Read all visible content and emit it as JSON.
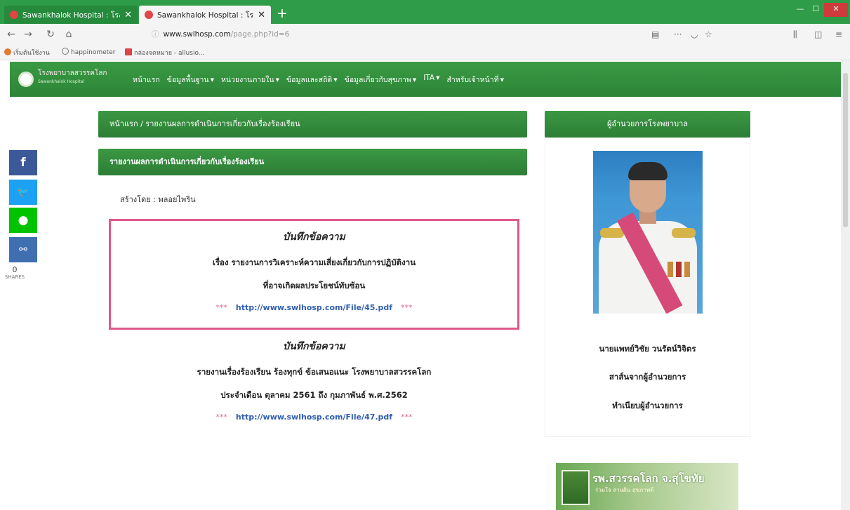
{
  "browser": {
    "tabs": [
      {
        "title": "Sawankhalok Hospital : โรงพ..."
      },
      {
        "title": "Sawankhalok Hospital : โรงพ..."
      }
    ],
    "new_tab": "+",
    "url_host": "www.swlhosp.com",
    "url_path": "/page.php?id=6",
    "bookmarks": [
      "เริ่มต้นใช้งาน",
      "happinometer",
      "กล่องจดหมาย - allusio..."
    ]
  },
  "site": {
    "logo_name": "โรงพยาบาลสวรรคโลก",
    "logo_sub": "Sawankhalok Hospital",
    "menu": [
      {
        "label": "หน้าแรก",
        "has_caret": false
      },
      {
        "label": "ข้อมูลพื้นฐาน",
        "has_caret": true
      },
      {
        "label": "หน่วยงานภายใน",
        "has_caret": true
      },
      {
        "label": "ข้อมูลและสถิติ",
        "has_caret": true
      },
      {
        "label": "ข้อมูลเกี่ยวกับสุขภาพ",
        "has_caret": true
      },
      {
        "label": "ITA",
        "has_caret": true
      },
      {
        "label": "สำหรับเจ้าหน้าที่",
        "has_caret": true
      }
    ]
  },
  "social": {
    "share_count": "0",
    "share_label": "SHARES",
    "colors": {
      "facebook": "#3b5998",
      "twitter": "#1da1f2",
      "line": "#00c300",
      "link": "#3f6fb0"
    }
  },
  "main": {
    "breadcrumb": "หน้าแรก / รายงานผลการดำเนินการเกี่ยวกับเรื่องร้องเรียน",
    "panel_title": "รายงานผลการดำเนินการเกี่ยวกับเรื่องร้องเรียน",
    "author": "สร้างโดย : พลอยไพริน",
    "memos": [
      {
        "title": "บันทึกข้อความ",
        "line1": "เรื่อง รายงานการวิเคราะห์ความเสี่ยงเกี่ยวกับการปฏิบัติงาน",
        "line2": "ที่อาจเกิดผลประโยชน์ทับซ้อน",
        "link": "http://www.swlhosp.com/File/45.pdf",
        "stars": "***"
      },
      {
        "title": "บันทึกข้อความ",
        "line1": "รายงานเรื่องร้องเรียน ร้องทุกข์ ข้อเสนอแนะ โรงพยาบาลสวรรคโลก",
        "line2": "ประจำเดือน ตุลาคม 2561 ถึง กุมภาพันธ์ พ.ศ.2562",
        "link": "http://www.swlhosp.com/File/47.pdf",
        "stars": "***"
      }
    ]
  },
  "sidebar": {
    "title": "ผู้อำนวยการโรงพยาบาล",
    "name": "นายแพทย์วิชัย วนรัตน์วิจิตร",
    "link1": "สาส์นจากผู้อำนวยการ",
    "link2": "ทำเนียบผู้อำนวยการ",
    "banner_title": "รพ.สวรรคโลก จ.สุโขทัย",
    "banner_sub": "ร่วมใจ สานฝัน สุขภาพดี"
  },
  "colors": {
    "header_green": "#2f8f3a",
    "memo_border": "#e0588a",
    "link_blue": "#2e5eb0"
  }
}
